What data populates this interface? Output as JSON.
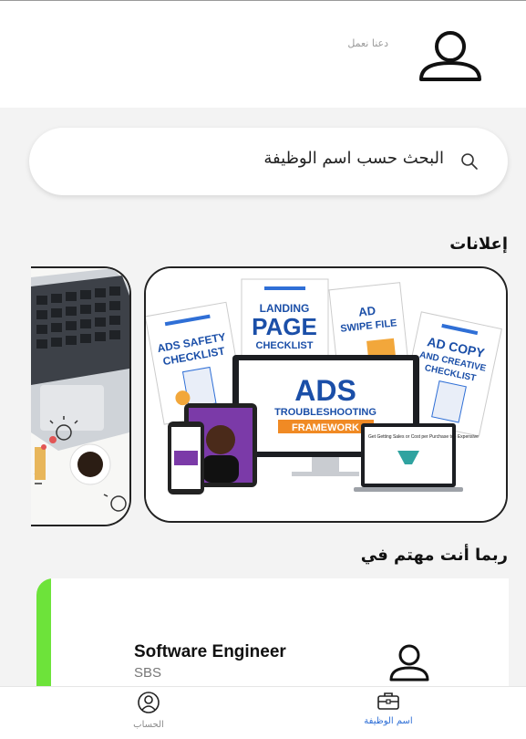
{
  "header": {
    "greeting": "دعنا نعمل",
    "avatar_icon": "user-icon"
  },
  "search": {
    "placeholder": "البحث حسب اسم الوظيفة",
    "icon": "search-icon"
  },
  "ads": {
    "title": "إعلانات",
    "banner": {
      "doc1": [
        "ADS SAFETY",
        "CHECKLIST"
      ],
      "doc2": [
        "LANDING",
        "PAGE",
        "CHECKLIST"
      ],
      "doc3": [
        "AD",
        "SWIPE FILE"
      ],
      "doc4": [
        "AD COPY",
        "AND CREATIVE",
        "CHECKLIST"
      ],
      "monitor": [
        "ADS",
        "TROUBLESHOOTING",
        "FRAMEWORK"
      ],
      "laptop_caption": "Get Getting Sales or Cost per Purchase too Expensive"
    }
  },
  "interest": {
    "title": "ربما أنت مهتم في",
    "jobs": [
      {
        "title": "Software Engineer",
        "company": "SBS"
      }
    ]
  },
  "nav": {
    "jobs_label": "اسم الوظيفة",
    "account_label": "الحساب"
  },
  "colors": {
    "accent_green": "#6de33a",
    "nav_active": "#2f6fd6"
  }
}
